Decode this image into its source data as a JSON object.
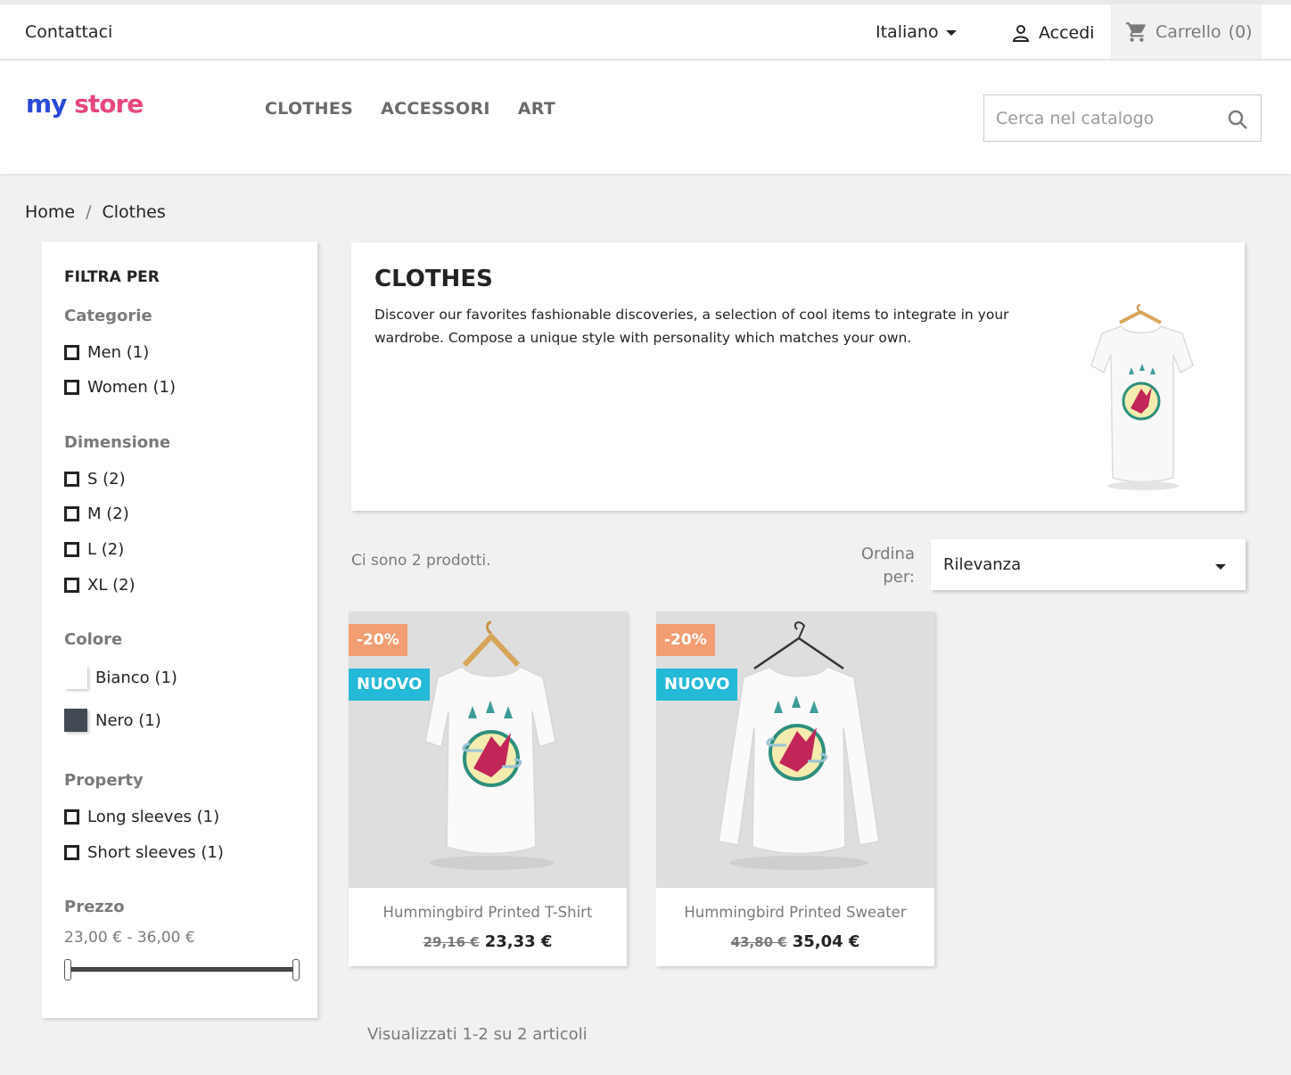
{
  "topbar": {
    "contact_label": "Contattaci",
    "language_label": "Italiano",
    "login_label": "Accedi",
    "cart_label": "Carrello",
    "cart_count": "(0)"
  },
  "header": {
    "logo_part1": "my",
    "logo_part2": "store",
    "nav": [
      {
        "label": "CLOTHES"
      },
      {
        "label": "ACCESSORI"
      },
      {
        "label": "ART"
      }
    ],
    "search_placeholder": "Cerca nel catalogo"
  },
  "breadcrumb": {
    "items": [
      "Home",
      "Clothes"
    ],
    "separator": "/"
  },
  "filters": {
    "heading": "FILTRA PER",
    "categories": {
      "title": "Categorie",
      "options": [
        "Men (1)",
        "Women (1)"
      ]
    },
    "size": {
      "title": "Dimensione",
      "options": [
        "S (2)",
        "M (2)",
        "L (2)",
        "XL (2)"
      ]
    },
    "color": {
      "title": "Colore",
      "options": [
        {
          "label": "Bianco (1)",
          "color": "#ffffff"
        },
        {
          "label": "Nero (1)",
          "color": "#434a54"
        }
      ]
    },
    "property": {
      "title": "Property",
      "options": [
        "Long sleeves (1)",
        "Short sleeves (1)"
      ]
    },
    "price": {
      "title": "Prezzo",
      "range": "23,00 € - 36,00 €"
    }
  },
  "category": {
    "title": "CLOTHES",
    "description": "Discover our favorites fashionable discoveries, a selection of cool items to integrate in your wardrobe. Compose a unique style with personality which matches your own."
  },
  "listing": {
    "count_text": "Ci sono 2 prodotti.",
    "sort_label": "Ordina per:",
    "sort_value": "Rilevanza",
    "pagination_text": "Visualizzati 1-2 su 2 articoli"
  },
  "products": [
    {
      "name": "Hummingbird Printed T-Shirt",
      "old_price": "29,16 €",
      "price": "23,33 €",
      "discount": "-20%",
      "flag": "NUOVO"
    },
    {
      "name": "Hummingbird Printed Sweater",
      "old_price": "43,80 €",
      "price": "35,04 €",
      "discount": "-20%",
      "flag": "NUOVO"
    }
  ],
  "colors": {
    "accent_new": "#24b9d7",
    "accent_discount": "#f39d72",
    "text_dark": "#232323",
    "text_muted": "#7a7a7a"
  }
}
